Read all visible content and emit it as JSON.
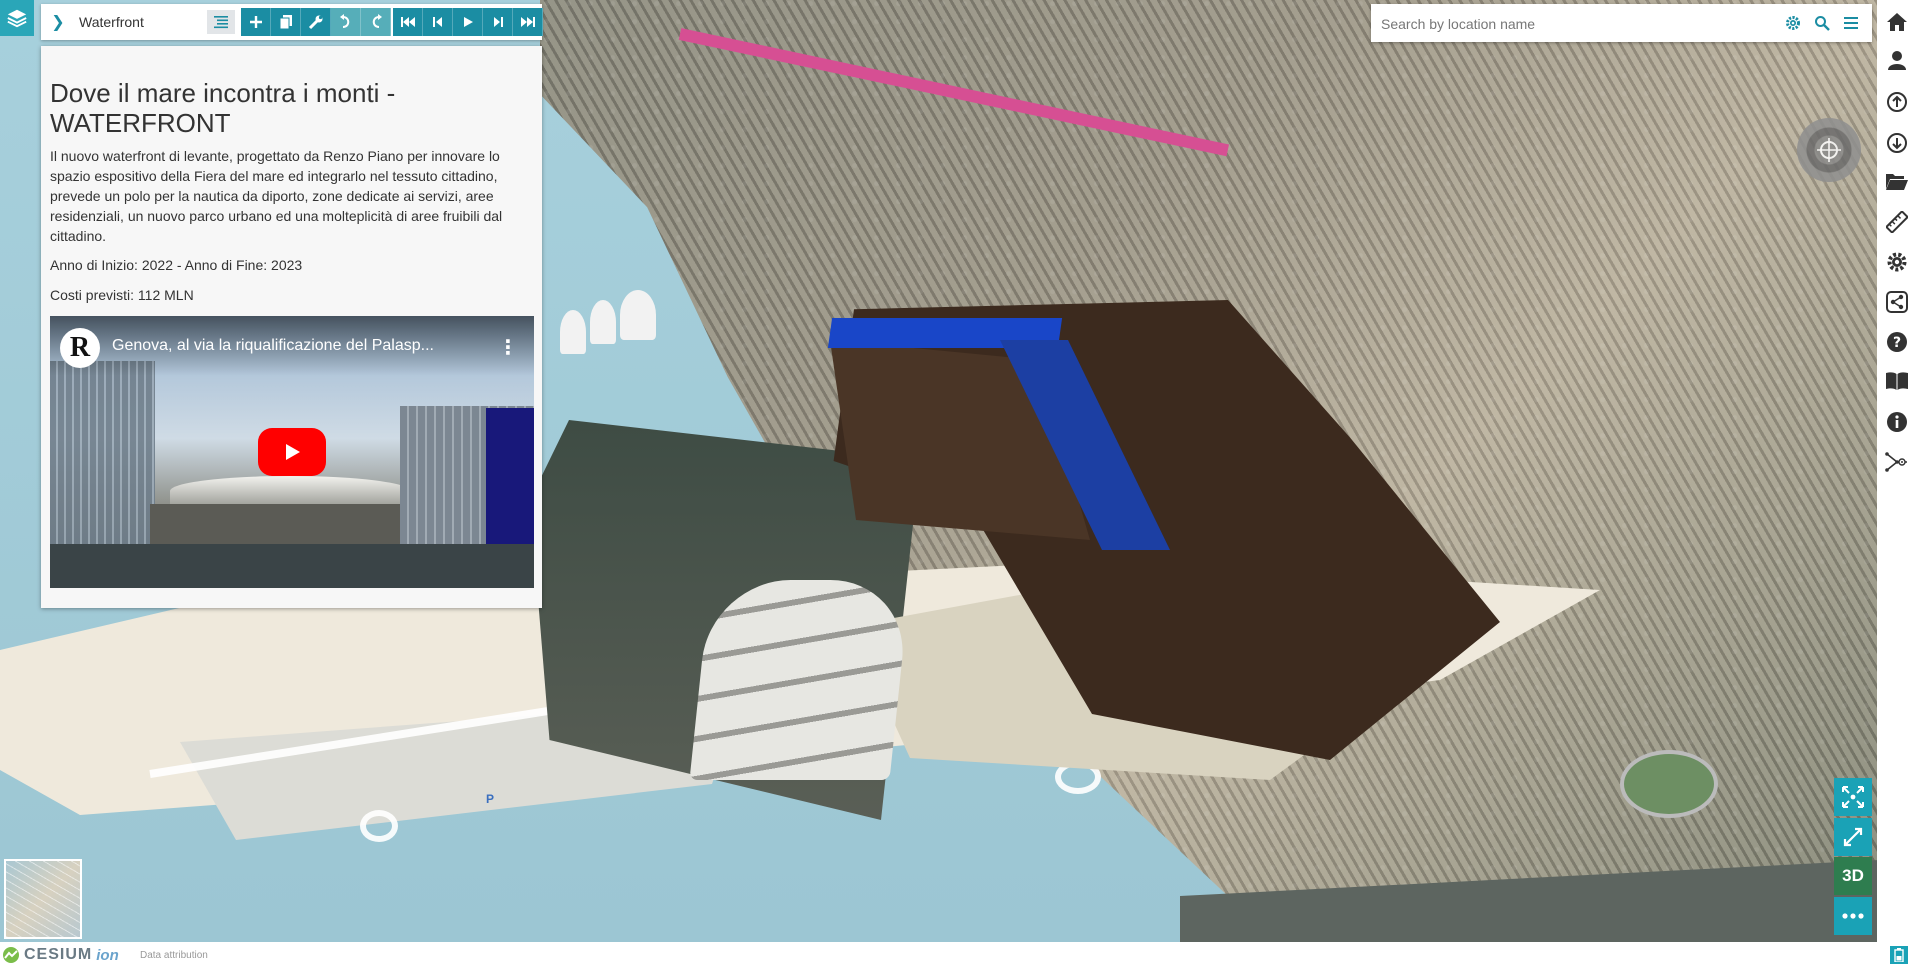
{
  "toolbar": {
    "story_title": "Waterfront"
  },
  "story": {
    "title": "Dove il mare incontra i monti - WATERFRONT",
    "description": "Il nuovo waterfront di levante, progettato da Renzo Piano per innovare lo spazio espositivo della Fiera del mare ed integrarlo nel tessuto cittadino, prevede un polo per la nautica da diporto, zone dedicate ai servizi, aree residenziali, un nuovo parco urbano ed una molteplicità di aree fruibili dal cittadino.",
    "years": "Anno di Inizio: 2022 - Anno di Fine: 2023",
    "costs": "Costi previsti: 112 MLN",
    "video": {
      "channel_logo": "R",
      "title": "Genova, al via la riqualificazione del Palasp..."
    }
  },
  "search": {
    "placeholder": "Search by location name"
  },
  "map": {
    "parking_label": "P",
    "mode_label": "3D"
  },
  "credits": {
    "cesium": "CESIUM",
    "ion": "ion",
    "data_attribution": "Data attribution"
  },
  "colors": {
    "accent": "#1b8da3",
    "accent_light": "#1aa2b6",
    "mode_button": "#2e7d4f",
    "youtube_red": "#ff0000"
  },
  "icons": {
    "right_toolbar": [
      "home-icon",
      "user-icon",
      "upload-icon",
      "download-icon",
      "folder-open-icon",
      "ruler-icon",
      "gear-icon",
      "share-icon",
      "help-icon",
      "book-icon",
      "info-icon",
      "tour-icon"
    ],
    "story_tools": [
      "plus-icon",
      "copy-icon",
      "wrench-icon",
      "undo-icon",
      "redo-icon"
    ],
    "story_nav": [
      "first-icon",
      "previous-icon",
      "play-icon",
      "next-icon",
      "last-icon"
    ]
  }
}
